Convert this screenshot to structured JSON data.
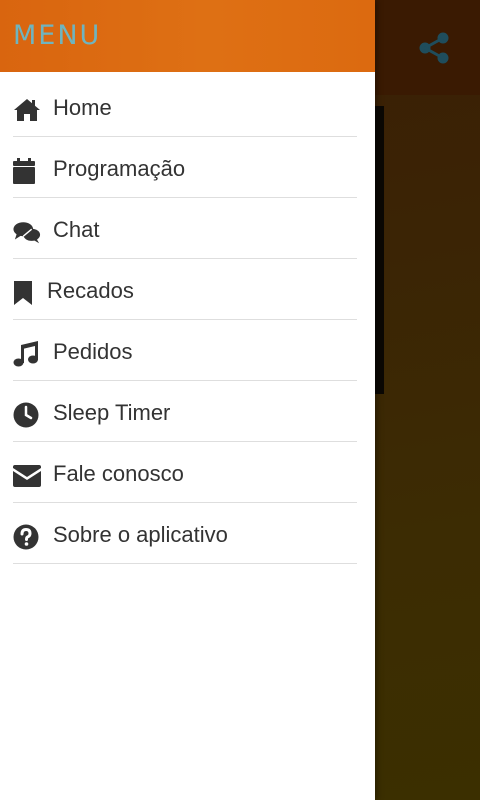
{
  "drawer": {
    "title": "MENU",
    "items": [
      {
        "label": "Home",
        "icon": "home-icon"
      },
      {
        "label": "Programação",
        "icon": "calendar-icon"
      },
      {
        "label": "Chat",
        "icon": "chat-icon"
      },
      {
        "label": "Recados",
        "icon": "bookmark-icon"
      },
      {
        "label": "Pedidos",
        "icon": "music-note-icon"
      },
      {
        "label": "Sleep Timer",
        "icon": "clock-icon"
      },
      {
        "label": "Fale conosco",
        "icon": "envelope-icon"
      },
      {
        "label": "Sobre o aplicativo",
        "icon": "question-circle-icon"
      }
    ]
  },
  "background": {
    "share_icon": "share-icon"
  },
  "colors": {
    "header": "#de7014",
    "title": "#6fb4bf",
    "text": "#333333",
    "share_icon": "#1f4d5c"
  }
}
